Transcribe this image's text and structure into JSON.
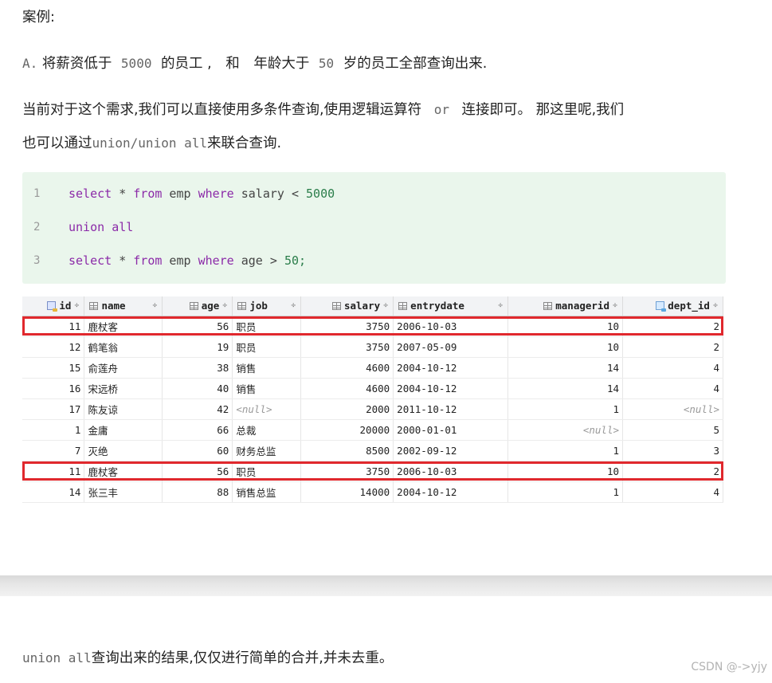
{
  "heading": "案例:",
  "paragraph_a": {
    "prefix": "A.",
    "t1": "将薪资低于",
    "v1": "5000",
    "t2": "的员工 ,",
    "t3": "和",
    "t4": "年龄大于",
    "v2": "50",
    "t5": "岁的员工全部查询出来."
  },
  "paragraph_b": {
    "t1": "当前对于这个需求,我们可以直接使用多条件查询,使用逻辑运算符",
    "op": "or",
    "t2": "连接即可。 那这里呢,我们",
    "t3": "也可以通过",
    "code": "union/union all",
    "t4": "来联合查询."
  },
  "code": {
    "lines": [
      {
        "num": "1",
        "k1": "select",
        "t1": " * ",
        "k2": "from",
        "t2": " emp ",
        "k3": "where",
        "t3": " salary < ",
        "n": "5000"
      },
      {
        "num": "2",
        "k1": "union",
        "t1": " ",
        "k2": "all",
        "t2": "",
        "k3": "",
        "t3": "",
        "n": ""
      },
      {
        "num": "3",
        "k1": "select",
        "t1": " * ",
        "k2": "from",
        "t2": " emp ",
        "k3": "where",
        "t3": " age > ",
        "n": "50;"
      }
    ]
  },
  "table": {
    "headers": [
      "id",
      "name",
      "age",
      "job",
      "salary",
      "entrydate",
      "managerid",
      "dept_id"
    ],
    "sort_glyph": "÷",
    "rows": [
      [
        "11",
        "鹿杖客",
        "56",
        "职员",
        "3750",
        "2006-10-03",
        "10",
        "2"
      ],
      [
        "12",
        "鹤笔翁",
        "19",
        "职员",
        "3750",
        "2007-05-09",
        "10",
        "2"
      ],
      [
        "15",
        "俞莲舟",
        "38",
        "销售",
        "4600",
        "2004-10-12",
        "14",
        "4"
      ],
      [
        "16",
        "宋远桥",
        "40",
        "销售",
        "4600",
        "2004-10-12",
        "14",
        "4"
      ],
      [
        "17",
        "陈友谅",
        "42",
        "<null>",
        "2000",
        "2011-10-12",
        "1",
        "<null>"
      ],
      [
        "1",
        "金庸",
        "66",
        "总裁",
        "20000",
        "2000-01-01",
        "<null>",
        "5"
      ],
      [
        "7",
        "灭绝",
        "60",
        "财务总监",
        "8500",
        "2002-09-12",
        "1",
        "3"
      ],
      [
        "11",
        "鹿杖客",
        "56",
        "职员",
        "3750",
        "2006-10-03",
        "10",
        "2"
      ],
      [
        "14",
        "张三丰",
        "88",
        "销售总监",
        "14000",
        "2004-10-12",
        "1",
        "4"
      ]
    ]
  },
  "footer_text": {
    "code": "union all",
    "text": "查询出来的结果,仅仅进行简单的合并,并未去重。"
  },
  "watermark": "CSDN @->yjy",
  "colors": {
    "highlight": "#e0282d",
    "code_bg": "#eaf6ec",
    "keyword": "#8b2aa8"
  }
}
